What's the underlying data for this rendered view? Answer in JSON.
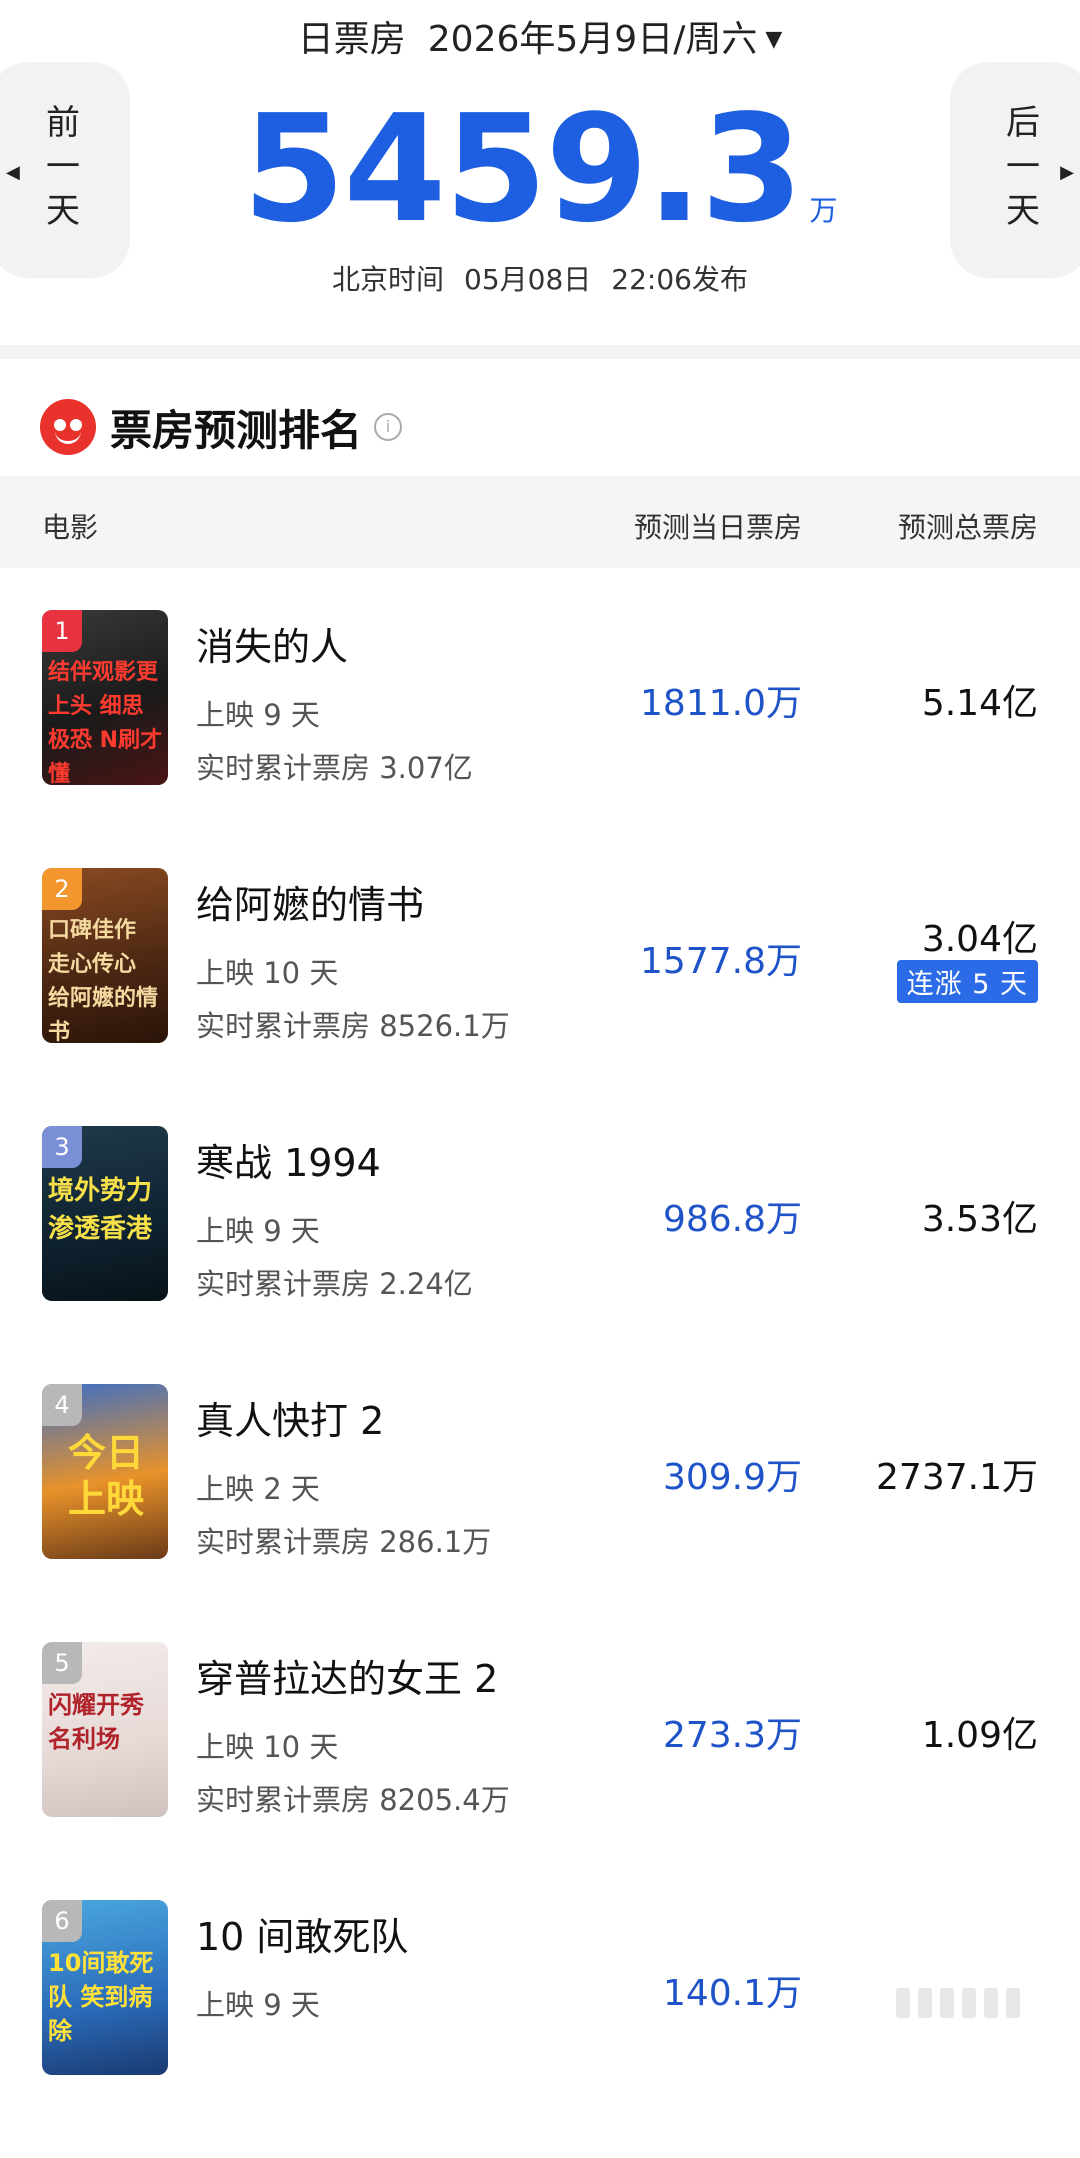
{
  "header": {
    "label": "日票房",
    "date": "2026年5月9日/周六",
    "prev_label": "前一天",
    "next_label": "后一天",
    "total": "5459.3",
    "unit": "万",
    "release_prefix": "北京时间",
    "release_date": "05月08日",
    "release_time": "22:06发布"
  },
  "section": {
    "title": "票房预测排名"
  },
  "table": {
    "col_movie": "电影",
    "col_today": "预测当日票房",
    "col_total": "预测总票房"
  },
  "movies": [
    {
      "rank": "1",
      "name": "消失的人",
      "days": "上映 9 天",
      "cumulative": "实时累计票房 3.07亿",
      "today": "1811.0万",
      "total": "5.14亿",
      "badge": "",
      "poster_text": "结伴观影更上头 细思极恐 N刷才懂"
    },
    {
      "rank": "2",
      "name": "给阿嬷的情书",
      "days": "上映 10 天",
      "cumulative": "实时累计票房 8526.1万",
      "today": "1577.8万",
      "total": "3.04亿",
      "badge": "连涨 5 天",
      "poster_text": "口碑佳作 走心传心 给阿嬷的情书"
    },
    {
      "rank": "3",
      "name": "寒战 1994",
      "days": "上映 9 天",
      "cumulative": "实时累计票房 2.24亿",
      "today": "986.8万",
      "total": "3.53亿",
      "badge": "",
      "poster_text": "境外势力 渗透香港"
    },
    {
      "rank": "4",
      "name": "真人快打 2",
      "days": "上映 2 天",
      "cumulative": "实时累计票房 286.1万",
      "today": "309.9万",
      "total": "2737.1万",
      "badge": "",
      "poster_text": "今日 上映"
    },
    {
      "rank": "5",
      "name": "穿普拉达的女王 2",
      "days": "上映 10 天",
      "cumulative": "实时累计票房 8205.4万",
      "today": "273.3万",
      "total": "1.09亿",
      "badge": "",
      "poster_text": "闪耀开秀 名利场"
    },
    {
      "rank": "6",
      "name": "10 间敢死队",
      "days": "上映 9 天",
      "cumulative": "",
      "today": "140.1万",
      "total": "",
      "badge": "",
      "poster_text": "10间敢死队 笑到病除"
    }
  ],
  "colors": {
    "accent": "#1d5fe0",
    "value_blue": "#1f53c8",
    "logo_red": "#e8322b",
    "badge_blue": "#2b6be8"
  }
}
